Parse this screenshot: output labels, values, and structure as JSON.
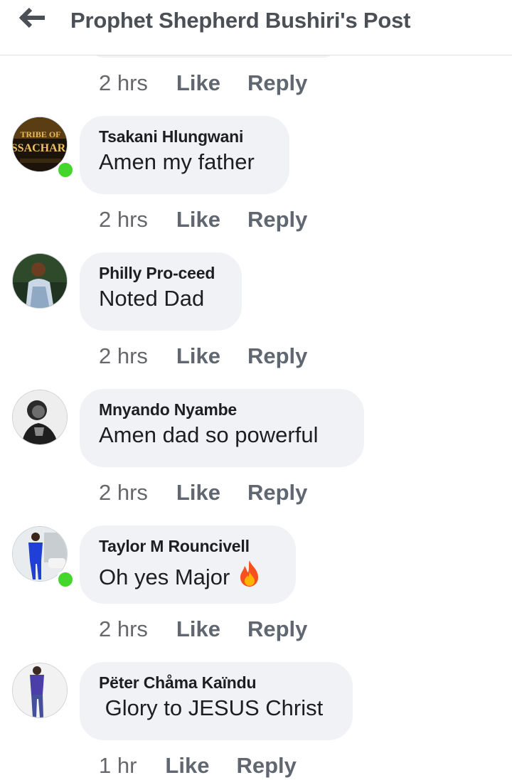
{
  "header": {
    "title": "Prophet Shepherd Bushiri's Post",
    "back_icon": "arrow-left-icon"
  },
  "colors": {
    "bubble": "#f0f2f5",
    "online": "#44d62c",
    "meta": "#65676b"
  },
  "previous_comment": {
    "time": "2 hrs",
    "like_label": "Like",
    "reply_label": "Reply"
  },
  "comments": [
    {
      "name": "Tsakani Hlungwani",
      "text": "Amen my father",
      "time": "2 hrs",
      "like_label": "Like",
      "reply_label": "Reply",
      "online": true,
      "avatar_text": "SSACHAR"
    },
    {
      "name": "Philly Pro-ceed",
      "text": "Noted Dad",
      "time": "2 hrs",
      "like_label": "Like",
      "reply_label": "Reply",
      "online": false
    },
    {
      "name": "Mnyando Nyambe",
      "text": "Amen dad so powerful",
      "time": "2 hrs",
      "like_label": "Like",
      "reply_label": "Reply",
      "online": false
    },
    {
      "name": "Taylor M Rouncivell",
      "text": "Oh yes Major",
      "emoji": "fire-icon",
      "time": "2 hrs",
      "like_label": "Like",
      "reply_label": "Reply",
      "online": true
    },
    {
      "name": "Pëter Chåma Kaïndu",
      "text": " Glory to JESUS Christ",
      "time": "1 hr",
      "like_label": "Like",
      "reply_label": "Reply",
      "online": false
    }
  ]
}
